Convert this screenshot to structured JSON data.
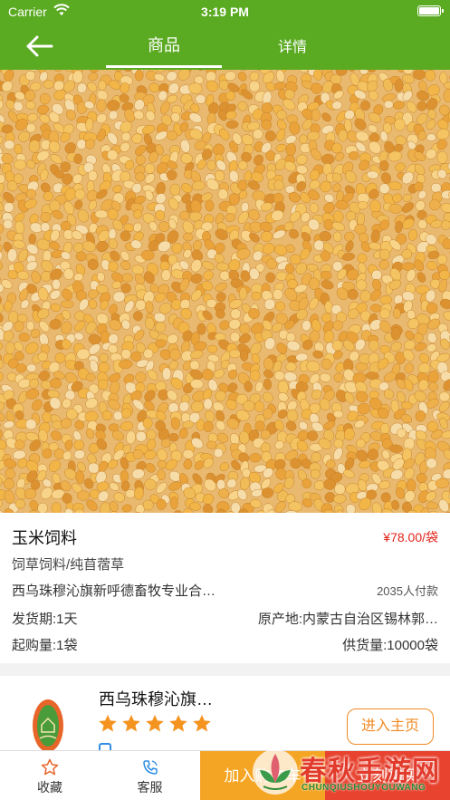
{
  "status_bar": {
    "carrier": "Carrier",
    "time": "3:19 PM"
  },
  "nav": {
    "tabs": [
      {
        "label": "商品",
        "active": true
      },
      {
        "label": "详情",
        "active": false
      }
    ]
  },
  "product": {
    "name": "玉米饲料",
    "price": "¥78.00/袋",
    "category": "饲草饲料/纯苜蓿草",
    "shop_line": "西乌珠穆沁旗新呼德畜牧专业合…",
    "paid_count": "2035人付款",
    "ship_time": "发货期:1天",
    "origin": "原产地:内蒙古自治区锡林郭…",
    "min_buy": "起购量:1袋",
    "supply": "供货量:10000袋"
  },
  "shop": {
    "name": "西乌珠穆沁旗…",
    "rating": 5,
    "enter_label": "进入主页"
  },
  "bottom_bar": {
    "favorite_label": "收藏",
    "service_label": "客服",
    "cart_label": "加入购物车",
    "buy_label": "立刻购买"
  },
  "watermark": {
    "title": "春秋手游网",
    "subtitle": "CHUNQIUSHOUYOUWANG"
  },
  "colors": {
    "brand_green": "#5aaa22",
    "price_red": "#e1251b",
    "star_orange": "#f5931f",
    "cart_orange": "#f5a524",
    "buy_red": "#e8432e"
  }
}
